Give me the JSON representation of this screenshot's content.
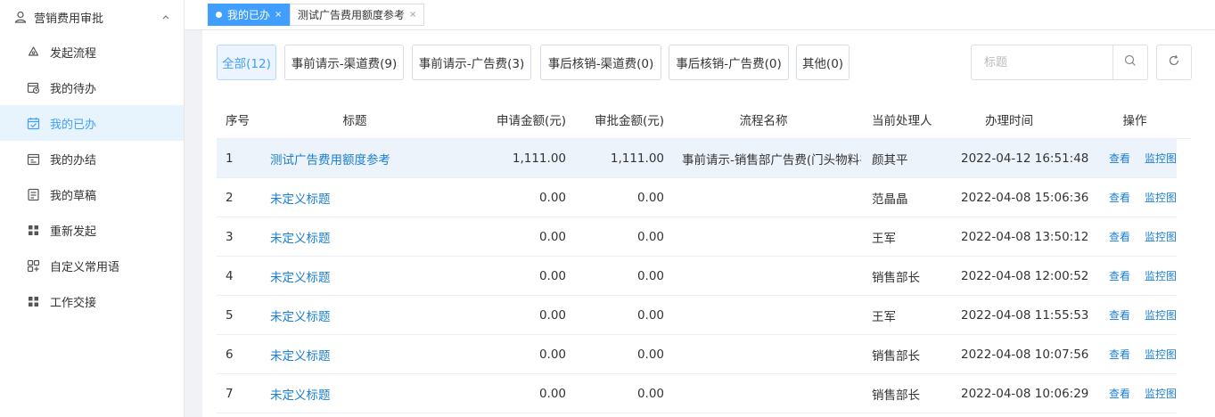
{
  "sidebar": {
    "header": "营销费用审批",
    "items": [
      {
        "label": "发起流程",
        "icon": "recycle-icon"
      },
      {
        "label": "我的待办",
        "icon": "calendar-clock-icon"
      },
      {
        "label": "我的已办",
        "icon": "calendar-check-icon"
      },
      {
        "label": "我的办结",
        "icon": "calendar-done-icon"
      },
      {
        "label": "我的草稿",
        "icon": "draft-icon"
      },
      {
        "label": "重新发起",
        "icon": "grid-icon"
      },
      {
        "label": "自定义常用语",
        "icon": "custom-grid-icon"
      },
      {
        "label": "工作交接",
        "icon": "grid-icon"
      }
    ]
  },
  "tabs": [
    {
      "label": "我的已办",
      "close": "×"
    },
    {
      "label": "测试广告费用额度参考",
      "close": "×"
    }
  ],
  "filters": [
    "全部(12)",
    "事前请示-渠道费(9)",
    "事前请示-广告费(3)",
    "事后核销-渠道费(0)",
    "事后核销-广告费(0)",
    "其他(0)"
  ],
  "search": {
    "placeholder": "标题"
  },
  "table": {
    "headers": [
      "序号",
      "标题",
      "申请金额(元)",
      "审批金额(元)",
      "流程名称",
      "当前处理人",
      "办理时间",
      "操作"
    ],
    "rows": [
      {
        "no": "1",
        "title": "测试广告费用额度参考",
        "apply": "1,111.00",
        "approve": "1,111.00",
        "flow": "事前请示-销售部广告费(门头物料⺷",
        "handler": "颜其平",
        "time": "2022-04-12 16:51:48",
        "view": "查看",
        "monitor": "监控图"
      },
      {
        "no": "2",
        "title": "未定义标题",
        "apply": "0.00",
        "approve": "0.00",
        "flow": "",
        "handler": "范晶晶",
        "time": "2022-04-08 15:06:36",
        "view": "查看",
        "monitor": "监控图"
      },
      {
        "no": "3",
        "title": "未定义标题",
        "apply": "0.00",
        "approve": "0.00",
        "flow": "",
        "handler": "王军",
        "time": "2022-04-08 13:50:12",
        "view": "查看",
        "monitor": "监控图"
      },
      {
        "no": "4",
        "title": "未定义标题",
        "apply": "0.00",
        "approve": "0.00",
        "flow": "",
        "handler": "销售部长",
        "time": "2022-04-08 12:00:52",
        "view": "查看",
        "monitor": "监控图"
      },
      {
        "no": "5",
        "title": "未定义标题",
        "apply": "0.00",
        "approve": "0.00",
        "flow": "",
        "handler": "王军",
        "time": "2022-04-08 11:55:53",
        "view": "查看",
        "monitor": "监控图"
      },
      {
        "no": "6",
        "title": "未定义标题",
        "apply": "0.00",
        "approve": "0.00",
        "flow": "",
        "handler": "销售部长",
        "time": "2022-04-08 10:07:56",
        "view": "查看",
        "monitor": "监控图"
      },
      {
        "no": "7",
        "title": "未定义标题",
        "apply": "0.00",
        "approve": "0.00",
        "flow": "",
        "handler": "销售部长",
        "time": "2022-04-08 10:06:29",
        "view": "查看",
        "monitor": "监控图"
      }
    ]
  },
  "colors": {
    "accent": "#409eff",
    "link": "#1a7fd3",
    "highlight_row": "#edf3fa"
  }
}
